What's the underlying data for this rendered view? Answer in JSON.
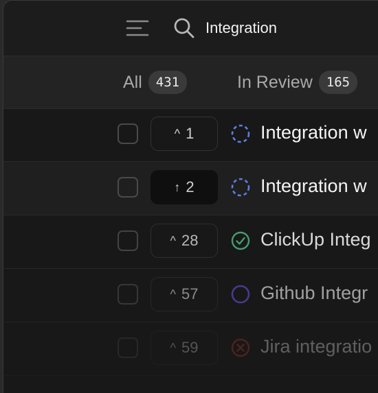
{
  "search": {
    "value": "Integration"
  },
  "tabs": [
    {
      "label": "All",
      "count": "431"
    },
    {
      "label": "In Review",
      "count": "165"
    }
  ],
  "rows": [
    {
      "votes": "1",
      "vote_icon": "chevron-up-icon",
      "vote_glyph": "^",
      "title": "Integration w",
      "status": "in-progress-icon"
    },
    {
      "votes": "2",
      "vote_icon": "arrow-up-icon",
      "vote_glyph": "↑",
      "title": "Integration w",
      "status": "in-progress-icon"
    },
    {
      "votes": "28",
      "vote_icon": "chevron-up-icon",
      "vote_glyph": "^",
      "title": "ClickUp Integ",
      "status": "completed-icon"
    },
    {
      "votes": "57",
      "vote_icon": "chevron-up-icon",
      "vote_glyph": "^",
      "title": "Github Integr",
      "status": "open-icon"
    },
    {
      "votes": "59",
      "vote_icon": "chevron-up-icon",
      "vote_glyph": "^",
      "title": "Jira integratio",
      "status": "closed-icon"
    }
  ],
  "colors": {
    "in_progress": "#5b7fe0",
    "completed": "#4caf7d",
    "open": "#6a4ed8",
    "closed": "#c0392b"
  }
}
